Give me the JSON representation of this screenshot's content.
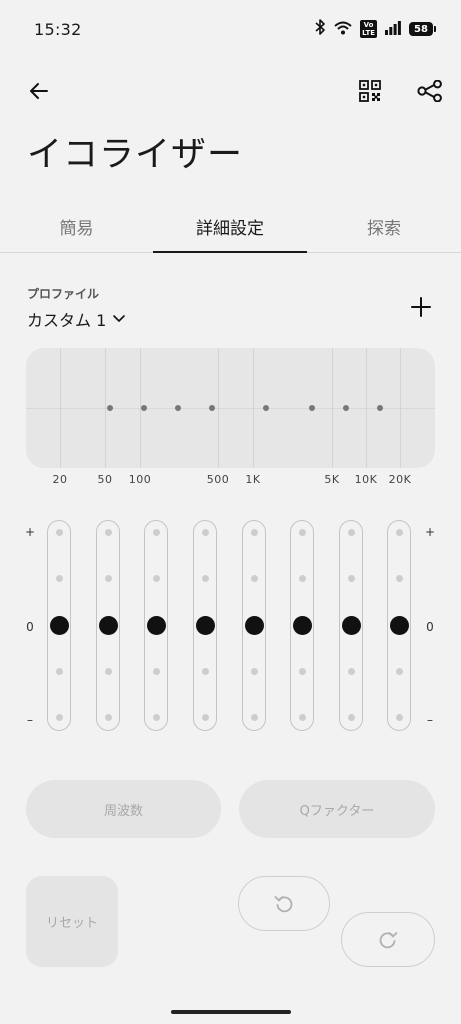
{
  "status": {
    "time": "15:32",
    "volte_label": "Vo\nLTE",
    "battery": "58"
  },
  "header": {
    "title": "イコライザー"
  },
  "tabs": [
    {
      "label": "簡易"
    },
    {
      "label": "詳細設定"
    },
    {
      "label": "探索"
    }
  ],
  "active_tab": "詳細設定",
  "profile": {
    "label": "プロファイル",
    "selected": "カスタム 1"
  },
  "graph": {
    "freq_labels": [
      "20",
      "50",
      "100",
      "500",
      "1K",
      "5K",
      "10K",
      "20K"
    ]
  },
  "sliders": {
    "plus": "+",
    "zero": "0",
    "minus": "–",
    "bands": 8,
    "levels": [
      0,
      0,
      0,
      0,
      0,
      0,
      0,
      0
    ]
  },
  "buttons": {
    "frequency": "周波数",
    "q_factor": "Qファクター",
    "reset": "リセット"
  },
  "colors": {
    "background": "#f2f2f2",
    "accent": "#111111",
    "disabled_fill": "#e3e4e3",
    "disabled_text": "#a8a8a8"
  }
}
